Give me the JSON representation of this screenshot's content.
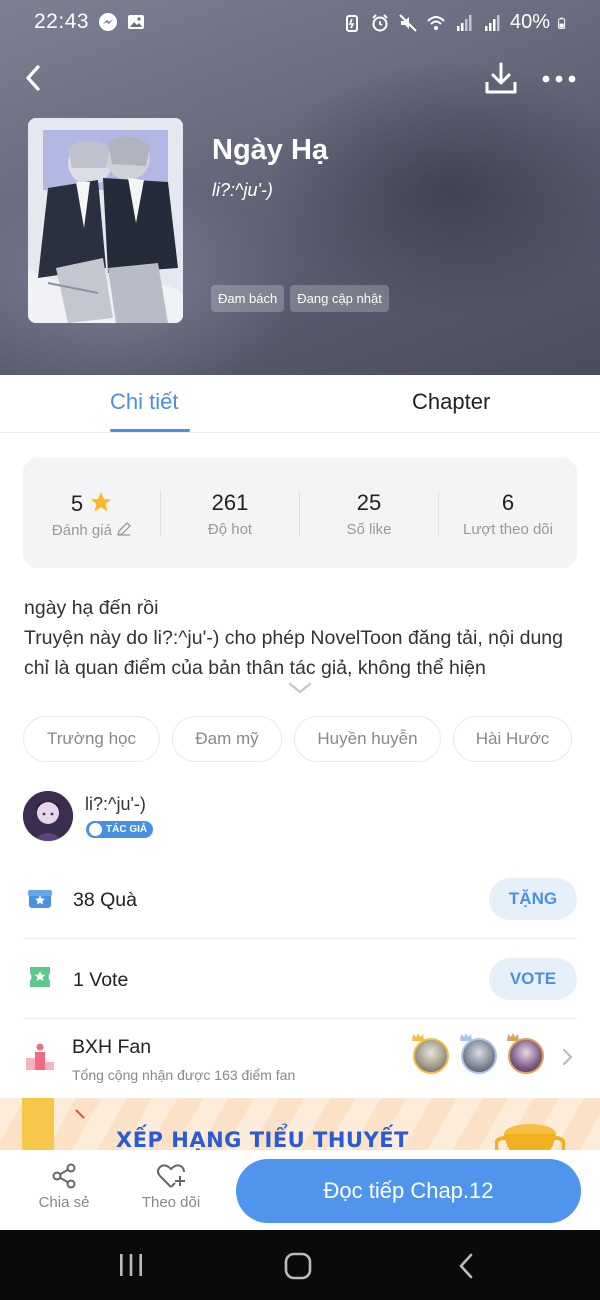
{
  "status": {
    "time": "22:43",
    "battery": "40%"
  },
  "book": {
    "title": "Ngày Hạ",
    "author": "li?:^ju'-)",
    "tags": [
      "Đam bách",
      "Đang cập nhật"
    ]
  },
  "tabs": {
    "detail": "Chi tiết",
    "chapter": "Chapter"
  },
  "stats": [
    {
      "value": "5",
      "label": "Đánh giá"
    },
    {
      "value": "261",
      "label": "Độ hot"
    },
    {
      "value": "25",
      "label": "Số like"
    },
    {
      "value": "6",
      "label": "Lượt theo dõi"
    }
  ],
  "description": {
    "line1": "ngày hạ đến rồi",
    "line2": "Truyện này do li?:^ju'-) cho phép NovelToon đăng tải, nội dung chỉ là quan điểm của bản thân tác giả, không thể hiện"
  },
  "genres": [
    "Trường học",
    "Đam mỹ",
    "Huyền huyễn",
    "Hài Hước"
  ],
  "author_section": {
    "name": "li?:^ju'-)",
    "badge": "TÁC GIẢ"
  },
  "gift": {
    "text": "38 Quà",
    "button": "TẶNG"
  },
  "vote": {
    "text": "1 Vote",
    "button": "VOTE"
  },
  "fan_rank": {
    "title": "BXH Fan",
    "subtitle": "Tổng cộng nhận được 163 điểm fan"
  },
  "banner": {
    "text": "XẾP HẠNG TIỂU THUYẾT"
  },
  "actions": {
    "share": "Chia sẻ",
    "follow": "Theo dõi",
    "read": "Đọc tiếp Chap.12"
  },
  "colors": {
    "accent": "#4a90e2",
    "read_button": "#4f95ee",
    "vote_icon": "#5cc98a",
    "star": "#f7b928"
  }
}
